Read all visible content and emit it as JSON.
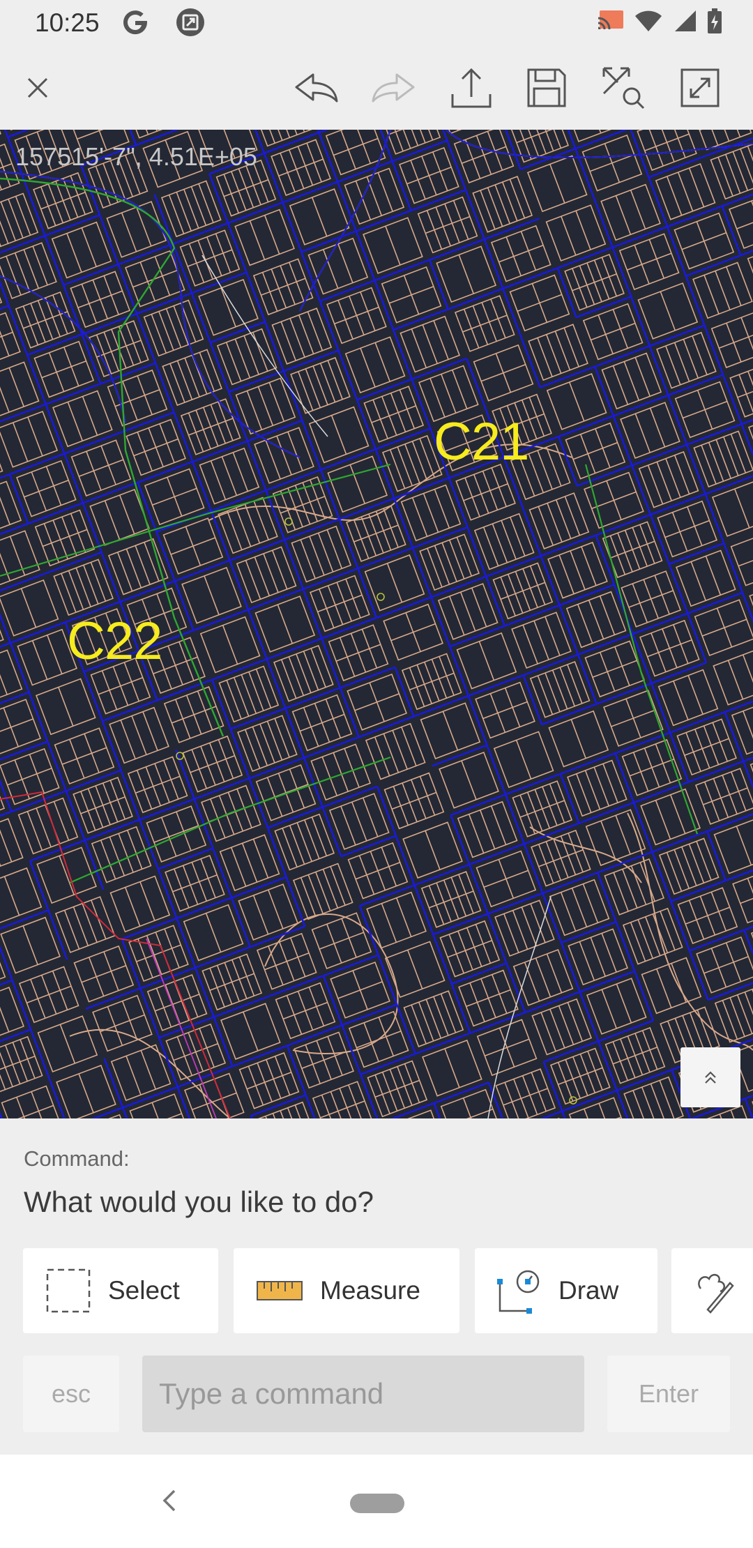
{
  "status_bar": {
    "time": "10:25",
    "icons": [
      "google-icon",
      "screenshot-icon",
      "cast-icon",
      "wifi-icon",
      "signal-icon",
      "battery-charging-icon"
    ]
  },
  "toolbar": {
    "buttons": [
      "close-icon",
      "undo-icon",
      "redo-icon",
      "share-icon",
      "save-icon",
      "zoom-extents-icon",
      "fullscreen-icon"
    ]
  },
  "canvas": {
    "coordinates": "157515'-7\", 4.51E+05",
    "labels": [
      "C21",
      "C22"
    ],
    "colors": {
      "background": "#232834",
      "parcels": "#d9a98a",
      "pipes": "#1a1ad8",
      "green_lines": "#2fa82f",
      "labels": "#f7ec1d"
    }
  },
  "command": {
    "label": "Command:",
    "prompt": "What would you like to do?",
    "tools": [
      {
        "label": "Select",
        "icon": "select-box-icon"
      },
      {
        "label": "Measure",
        "icon": "ruler-icon"
      },
      {
        "label": "Draw",
        "icon": "draw-icon"
      },
      {
        "label": "",
        "icon": "sketch-icon"
      }
    ],
    "esc_label": "esc",
    "input_placeholder": "Type a command",
    "enter_label": "Enter"
  },
  "nav": {
    "icons": [
      "back-icon",
      "home-pill"
    ]
  }
}
